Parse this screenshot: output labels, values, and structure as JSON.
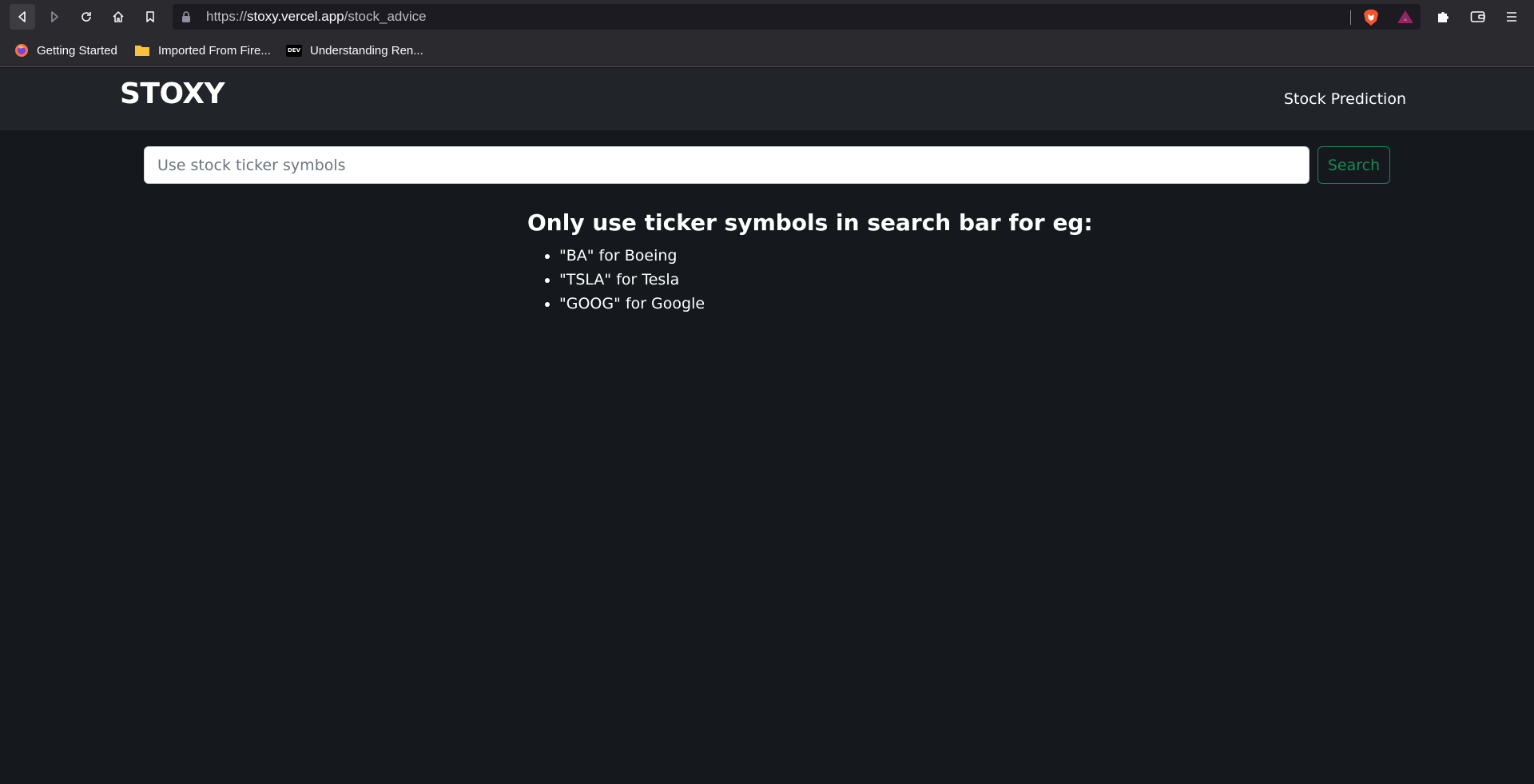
{
  "browser": {
    "url_scheme": "https://",
    "url_host": "stoxy.vercel.app",
    "url_path": "/stock_advice",
    "bookmarks": [
      {
        "label": "Getting Started",
        "icon": "firefox-icon"
      },
      {
        "label": "Imported From Fire...",
        "icon": "folder-icon"
      },
      {
        "label": "Understanding Ren...",
        "icon": "dev-icon",
        "badge": "DEV"
      }
    ]
  },
  "navbar": {
    "brand": "STOXY",
    "link": "Stock Prediction"
  },
  "search": {
    "placeholder": "Use stock ticker symbols",
    "value": "",
    "button_label": "Search"
  },
  "help": {
    "heading": "Only use ticker symbols in search bar for eg:",
    "examples": [
      "\"BA\" for Boeing",
      "\"TSLA\" for Tesla",
      "\"GOOG\" for Google"
    ]
  },
  "colors": {
    "page_bg": "#15191d",
    "navbar_bg": "#212429",
    "success_green": "#198754"
  }
}
